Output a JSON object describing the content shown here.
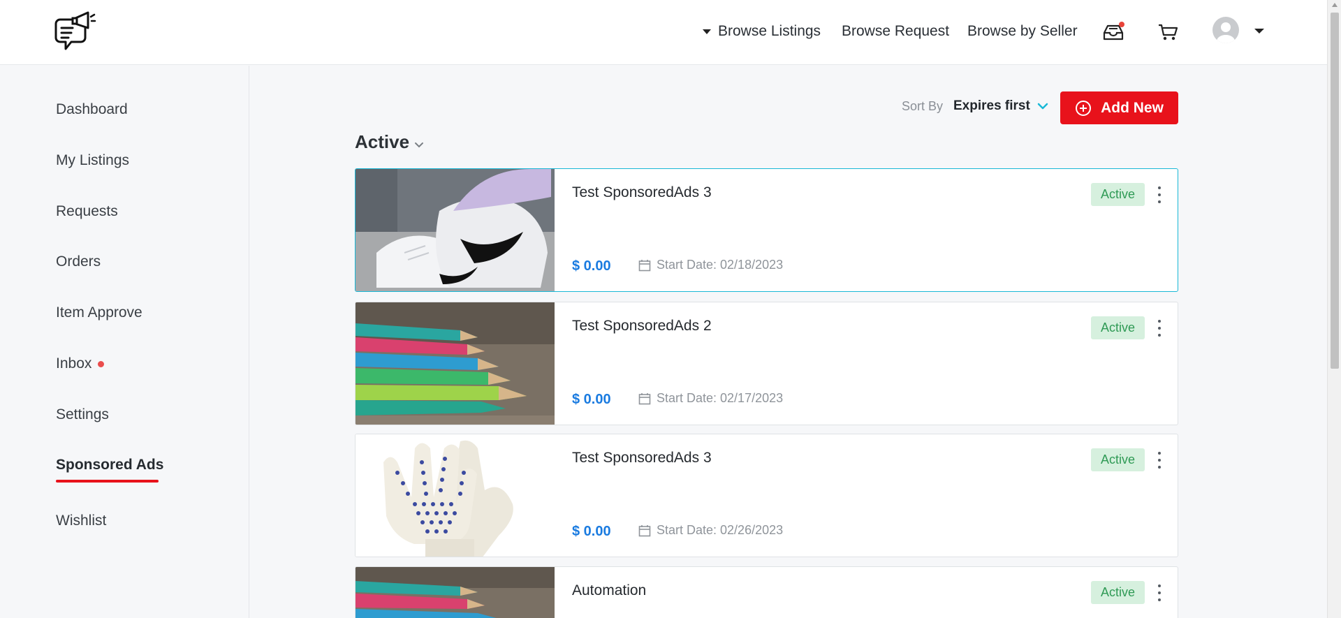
{
  "header": {
    "nav": {
      "browse_listings": "Browse Listings",
      "browse_request": "Browse Request",
      "browse_by_seller": "Browse by Seller"
    },
    "icons": [
      "logo-chat-megaphone",
      "inbox-tray-icon",
      "cart-icon",
      "avatar"
    ]
  },
  "sidebar": {
    "items": [
      {
        "label": "Dashboard"
      },
      {
        "label": "My Listings"
      },
      {
        "label": "Requests"
      },
      {
        "label": "Orders"
      },
      {
        "label": "Item Approve"
      },
      {
        "label": "Inbox"
      },
      {
        "label": "Settings"
      },
      {
        "label": "Sponsored Ads"
      },
      {
        "label": "Wishlist"
      }
    ],
    "active_index": 7
  },
  "toolbar": {
    "sort_label": "Sort By",
    "sort_value": "Expires first",
    "add_button": "Add New"
  },
  "section": {
    "title": "Active"
  },
  "ads": [
    {
      "title": "Test SponsoredAds 3",
      "price": "$ 0.00",
      "start_date": "Start Date: 02/18/2023",
      "status": "Active",
      "image": "sneakers"
    },
    {
      "title": "Test SponsoredAds 2",
      "price": "$ 0.00",
      "start_date": "Start Date: 02/17/2023",
      "status": "Active",
      "image": "colored-pencils"
    },
    {
      "title": "Test SponsoredAds 3",
      "price": "$ 0.00",
      "start_date": "Start Date: 02/26/2023",
      "status": "Active",
      "image": "gloves"
    },
    {
      "title": "Automation",
      "price": "",
      "start_date": "",
      "status": "Active",
      "image": "colored-pencils"
    }
  ],
  "colors": {
    "accent_red": "#e8121b",
    "price_blue": "#1a7be0",
    "selected_border": "#19b8d6",
    "badge_bg": "#d6f0de",
    "badge_text": "#2f9a55"
  }
}
